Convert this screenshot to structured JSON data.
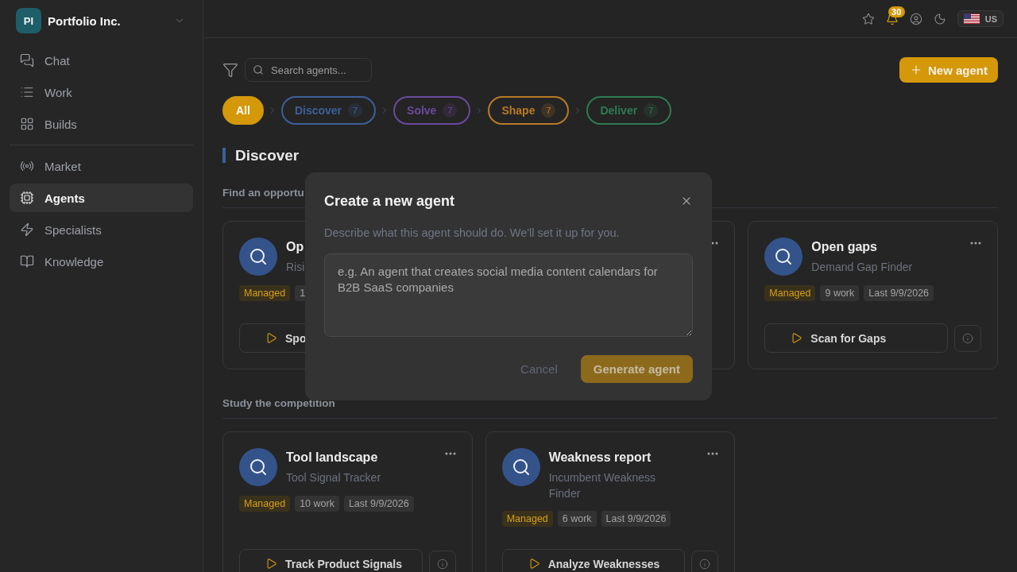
{
  "sidebar": {
    "workspace": {
      "initials": "PI",
      "name": "Portfolio Inc."
    },
    "nav_groups": [
      {
        "items": [
          {
            "label": "Chat",
            "selected": false
          },
          {
            "label": "Work",
            "selected": false
          },
          {
            "label": "Builds",
            "selected": false
          }
        ]
      },
      {
        "items": [
          {
            "label": "Market",
            "selected": false
          },
          {
            "label": "Agents",
            "selected": true
          },
          {
            "label": "Specialists",
            "selected": false
          },
          {
            "label": "Knowledge",
            "selected": false
          }
        ]
      }
    ]
  },
  "top_bar": {
    "notification_count": "30",
    "locale": "US"
  },
  "toolbar": {
    "search": {
      "placeholder": "Search agents..."
    },
    "new_button": "New agent"
  },
  "stages": [
    {
      "label": "All",
      "selected": true,
      "color": "#d4980a"
    },
    {
      "label": "Discover",
      "count": "7",
      "selected": false,
      "color": "#3d5f99"
    },
    {
      "label": "Solve",
      "count": "7",
      "selected": false,
      "color": "#6a4a9c"
    },
    {
      "label": "Shape",
      "count": "7",
      "selected": false,
      "color": "#b87a25"
    },
    {
      "label": "Deliver",
      "count": "7",
      "selected": false,
      "color": "#2f7a54"
    }
  ],
  "section": {
    "title": "Discover"
  },
  "groups": [
    {
      "title": "Find an opportu",
      "cards": [
        {
          "title": "Op",
          "subtitle": "Risi",
          "tags": [
            {
              "kind": "managed",
              "label": "Managed"
            },
            {
              "kind": "meta",
              "label": "1"
            }
          ],
          "action": "Spo"
        },
        {
          "more_button": true
        },
        {
          "title": "Open gaps",
          "subtitle": "Demand Gap Finder",
          "tags": [
            {
              "kind": "managed",
              "label": "Managed"
            },
            {
              "kind": "meta",
              "label": "9 work"
            },
            {
              "kind": "meta",
              "label": "Last 9/9/2026"
            }
          ],
          "action": "Scan for Gaps",
          "more_button": true,
          "info_button": true
        }
      ]
    },
    {
      "title": "Study the competition",
      "cards": [
        {
          "title": "Tool landscape",
          "subtitle": "Tool Signal Tracker",
          "tags": [
            {
              "kind": "managed",
              "label": "Managed"
            },
            {
              "kind": "meta",
              "label": "10 work"
            },
            {
              "kind": "meta",
              "label": "Last 9/9/2026"
            }
          ],
          "action": "Track Product Signals",
          "more_button": true,
          "info_button": true
        },
        {
          "title": "Weakness report",
          "subtitle": "Incumbent Weakness Finder",
          "tags": [
            {
              "kind": "managed",
              "label": "Managed"
            },
            {
              "kind": "meta",
              "label": "6 work"
            },
            {
              "kind": "meta",
              "label": "Last 9/9/2026"
            }
          ],
          "action": "Analyze Weaknesses",
          "more_button": true,
          "info_button": true
        }
      ]
    }
  ],
  "modal": {
    "title": "Create a new agent",
    "description": "Describe what this agent should do. We'll set it up for you.",
    "prompt": {
      "placeholder": "e.g. An agent that creates social media content calendars for B2B SaaS companies"
    },
    "buttons": [
      {
        "kind": "secondary",
        "label": "Cancel",
        "disabled": false
      },
      {
        "kind": "primary",
        "label": "Generate agent",
        "disabled": true
      }
    ]
  }
}
